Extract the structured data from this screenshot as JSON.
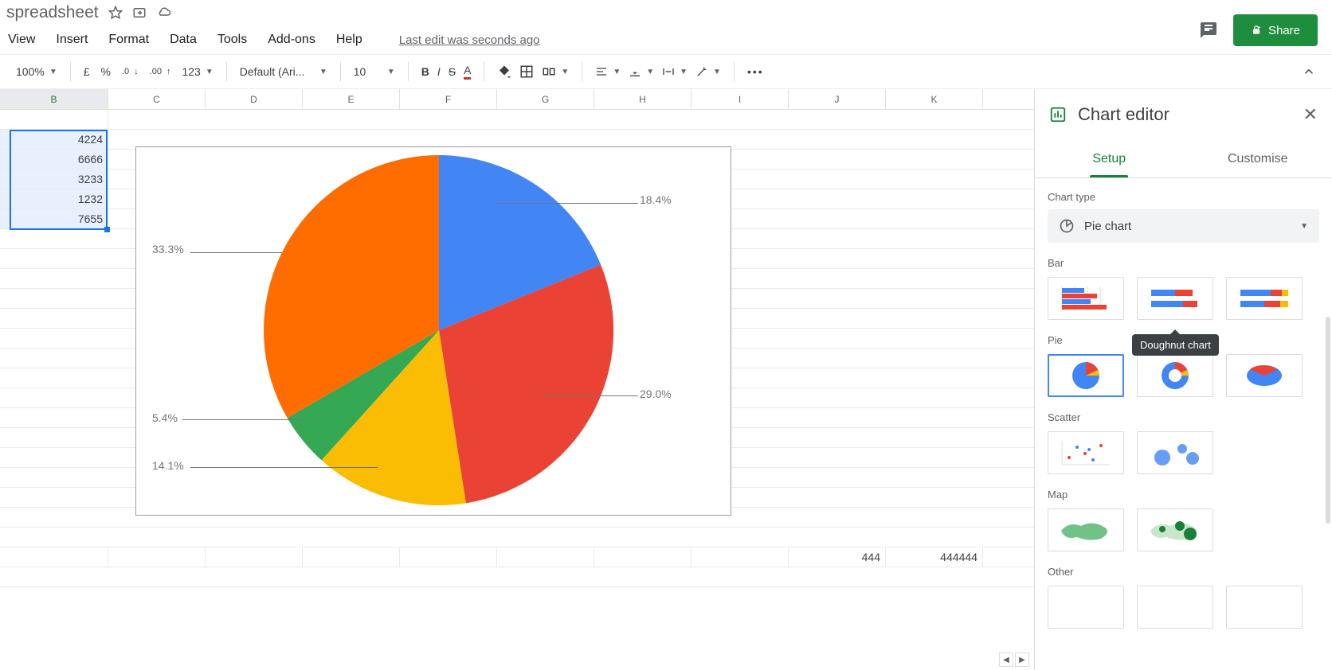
{
  "doc_title": "spreadsheet",
  "menu": [
    "View",
    "Insert",
    "Format",
    "Data",
    "Tools",
    "Add-ons",
    "Help"
  ],
  "last_edit": "Last edit was seconds ago",
  "share_label": "Share",
  "toolbar": {
    "zoom": "100%",
    "currency": "£",
    "percent": "%",
    "dec_dec": ".0",
    "dec_inc": ".00",
    "more_fmt": "123",
    "font": "Default (Ari...",
    "font_size": "10"
  },
  "columns": [
    "B",
    "C",
    "D",
    "E",
    "F",
    "G",
    "H",
    "I",
    "J",
    "K"
  ],
  "selected_column_index": 0,
  "cells_b": [
    "4224",
    "6666",
    "3233",
    "1232",
    "7655"
  ],
  "bottom_row_j": "444",
  "bottom_row_k": "444444",
  "chart_editor": {
    "title": "Chart editor",
    "tab_setup": "Setup",
    "tab_customise": "Customise",
    "chart_type_label": "Chart type",
    "chart_type_value": "Pie chart",
    "sections": {
      "bar": "Bar",
      "pie": "Pie",
      "scatter": "Scatter",
      "map": "Map",
      "other": "Other"
    },
    "tooltip": "Doughnut chart"
  },
  "pie_labels": {
    "p1": "18.4%",
    "p2": "29.0%",
    "p3": "14.1%",
    "p4": "5.4%",
    "p5": "33.3%"
  },
  "chart_data": {
    "type": "pie",
    "title": "",
    "categories": [
      "4224",
      "6666",
      "3233",
      "1232",
      "7655"
    ],
    "values": [
      4224,
      6666,
      3233,
      1232,
      7655
    ],
    "percentages": [
      18.4,
      29.0,
      14.1,
      5.4,
      33.3
    ],
    "colors": [
      "#4285f4",
      "#ea4335",
      "#fbbc04",
      "#34a853",
      "#ff6d01"
    ]
  }
}
